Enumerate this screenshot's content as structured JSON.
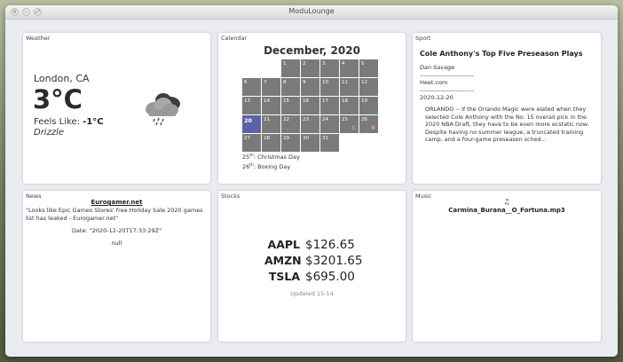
{
  "window": {
    "title": "ModuLounge"
  },
  "weather": {
    "label": "Weather",
    "city": "London, CA",
    "temp": "3°C",
    "feels_label": "Feels Like: ",
    "feels_value": "-1°C",
    "description": "Drizzle",
    "icon": "cloud-rain-icon"
  },
  "calendar": {
    "label": "Calendar",
    "month_title": "December, 2020",
    "today": 20,
    "holiday_markers": {
      "25": "C",
      "26": "B"
    },
    "holidays": [
      {
        "day": "25",
        "suffix": "th",
        "name": ": Christmas Day"
      },
      {
        "day": "26",
        "suffix": "th",
        "name": ": Boxing Day"
      }
    ]
  },
  "sport": {
    "label": "Sport",
    "title": "Cole Anthony's Top Five Preseason Plays",
    "author": "Dan Savage",
    "sep1": "--------------------------",
    "source": "Heet.com",
    "sep2": "--------------------------",
    "date": "2020-12-20",
    "body": "ORLANDO -- If the Orlando Magic were elated when they selected Cole Anthony with the No. 15 overall pick in the 2020 NBA Draft, they have to be even more ecstatic now. Despite having no summer league, a truncated training camp, and a four-game preseason sched..."
  },
  "news": {
    "label": "News",
    "source": "Eurogamer.net",
    "headline": "\"Looks like Epic Games Stores' free Holiday Sale 2020 games list has leaked - Eurogamer.net\"",
    "date": "Date: \"2020-12-20T17:33:29Z\"",
    "body": "null"
  },
  "stocks": {
    "label": "Stocks",
    "items": [
      {
        "symbol": "AAPL",
        "price": "$126.65"
      },
      {
        "symbol": "AMZN",
        "price": "$3201.65"
      },
      {
        "symbol": "TSLA",
        "price": "$695.00"
      }
    ],
    "updated": "Updated 15:14"
  },
  "music": {
    "label": "Music",
    "note_icon": "♫",
    "track": "Carmina_Burana__O_Fortuna.mp3"
  },
  "colors": {
    "calendar_cell": "#7a7a7a",
    "calendar_today": "#5b63a7",
    "holiday_marker": "#ff8fa3"
  }
}
